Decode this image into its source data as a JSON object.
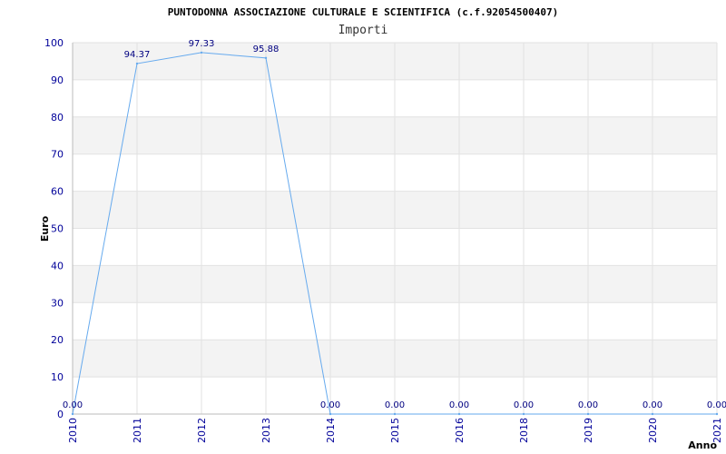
{
  "chart_data": {
    "type": "line",
    "title": "PUNTODONNA ASSOCIAZIONE CULTURALE E SCIENTIFICA (c.f.92054500407)",
    "subtitle": "Importi",
    "xlabel": "Anno",
    "ylabel": "Euro",
    "ylim": [
      0,
      100
    ],
    "yticks": [
      "0",
      "10",
      "20",
      "30",
      "40",
      "50",
      "60",
      "70",
      "80",
      "90",
      "100"
    ],
    "categories": [
      "2010",
      "2011",
      "2012",
      "2013",
      "2014",
      "2015",
      "2016",
      "2018",
      "2019",
      "2020",
      "2021"
    ],
    "series": [
      {
        "values": [
          0,
          94.37,
          97.33,
          95.88,
          0,
          0,
          0,
          0,
          0,
          0,
          0
        ],
        "labels": [
          "0.00",
          "94.37",
          "97.33",
          "95.88",
          "0.00",
          "0.00",
          "0.00",
          "0.00",
          "0.00",
          "0.00",
          "0.00"
        ]
      }
    ],
    "grid": true,
    "line_color": "#66aaee",
    "band_color": "#f3f3f3",
    "tick_color": "#000099"
  }
}
